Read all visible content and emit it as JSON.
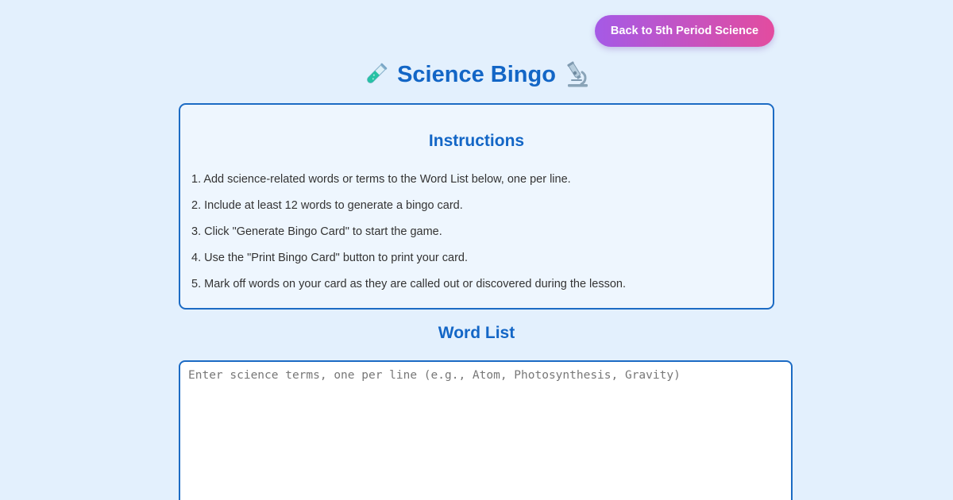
{
  "header": {
    "back_button_label": "Back to 5th Period Science",
    "title": "Science Bingo",
    "left_icon": "test-tube-icon",
    "right_icon": "microscope-icon"
  },
  "instructions": {
    "heading": "Instructions",
    "items": [
      "1. Add science-related words or terms to the Word List below, one per line.",
      "2. Include at least 12 words to generate a bingo card.",
      "3. Click \"Generate Bingo Card\" to start the game.",
      "4. Use the \"Print Bingo Card\" button to print your card.",
      "5. Mark off words on your card as they are called out or discovered during the lesson."
    ]
  },
  "word_list": {
    "heading": "Word List",
    "value": "",
    "placeholder": "Enter science terms, one per line (e.g., Atom, Photosynthesis, Gravity)"
  },
  "colors": {
    "background": "#e3f0fd",
    "accent": "#1366c6",
    "button_gradient_start": "#a55ae6",
    "button_gradient_end": "#e34c9f"
  }
}
